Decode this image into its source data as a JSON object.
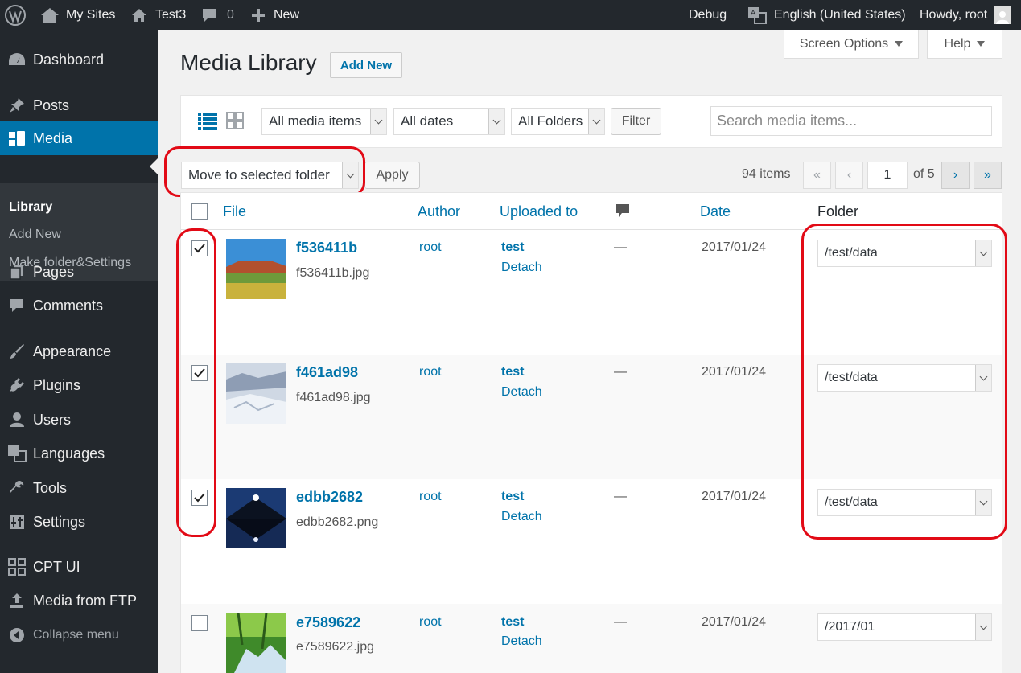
{
  "adminbar": {
    "my_sites": "My Sites",
    "site": "Test3",
    "comments": "0",
    "new": "New",
    "debug": "Debug",
    "language": "English (United States)",
    "howdy": "Howdy, root"
  },
  "menu": {
    "dashboard": "Dashboard",
    "posts": "Posts",
    "media": "Media",
    "library": "Library",
    "add_new": "Add New",
    "make_folder": "Make folder&Settings",
    "pages": "Pages",
    "comments": "Comments",
    "appearance": "Appearance",
    "plugins": "Plugins",
    "users": "Users",
    "languages": "Languages",
    "tools": "Tools",
    "settings": "Settings",
    "cpt_ui": "CPT UI",
    "media_ftp": "Media from FTP",
    "collapse": "Collapse menu"
  },
  "header": {
    "screen_options": "Screen Options",
    "help": "Help",
    "title": "Media Library",
    "add_new": "Add New"
  },
  "filters": {
    "media_type": "All media items",
    "dates": "All dates",
    "folders": "All Folders",
    "filter_btn": "Filter",
    "search_placeholder": "Search media items..."
  },
  "bulk": {
    "action": "Move to selected folder",
    "apply": "Apply"
  },
  "pagination": {
    "count": "94 items",
    "first": "«",
    "prev": "‹",
    "current": "1",
    "of": "of 5",
    "next": "›",
    "last": "»"
  },
  "columns": {
    "file": "File",
    "author": "Author",
    "uploaded_to": "Uploaded to",
    "date": "Date",
    "folder": "Folder"
  },
  "rows": [
    {
      "title": "f536411b",
      "filename": "f536411b.jpg",
      "author": "root",
      "uploaded_to": "test",
      "detach": "Detach",
      "comments": "—",
      "date": "2017/01/24",
      "folder": "/test/data",
      "checked": true
    },
    {
      "title": "f461ad98",
      "filename": "f461ad98.jpg",
      "author": "root",
      "uploaded_to": "test",
      "detach": "Detach",
      "comments": "—",
      "date": "2017/01/24",
      "folder": "/test/data",
      "checked": true
    },
    {
      "title": "edbb2682",
      "filename": "edbb2682.png",
      "author": "root",
      "uploaded_to": "test",
      "detach": "Detach",
      "comments": "—",
      "date": "2017/01/24",
      "folder": "/test/data",
      "checked": true
    },
    {
      "title": "e7589622",
      "filename": "e7589622.jpg",
      "author": "root",
      "uploaded_to": "test",
      "detach": "Detach",
      "comments": "—",
      "date": "2017/01/24",
      "folder": "/2017/01",
      "checked": false
    }
  ],
  "colors": {
    "accent": "#0073aa",
    "adminbar": "#23282d",
    "annotation_red": "#e20a16"
  }
}
